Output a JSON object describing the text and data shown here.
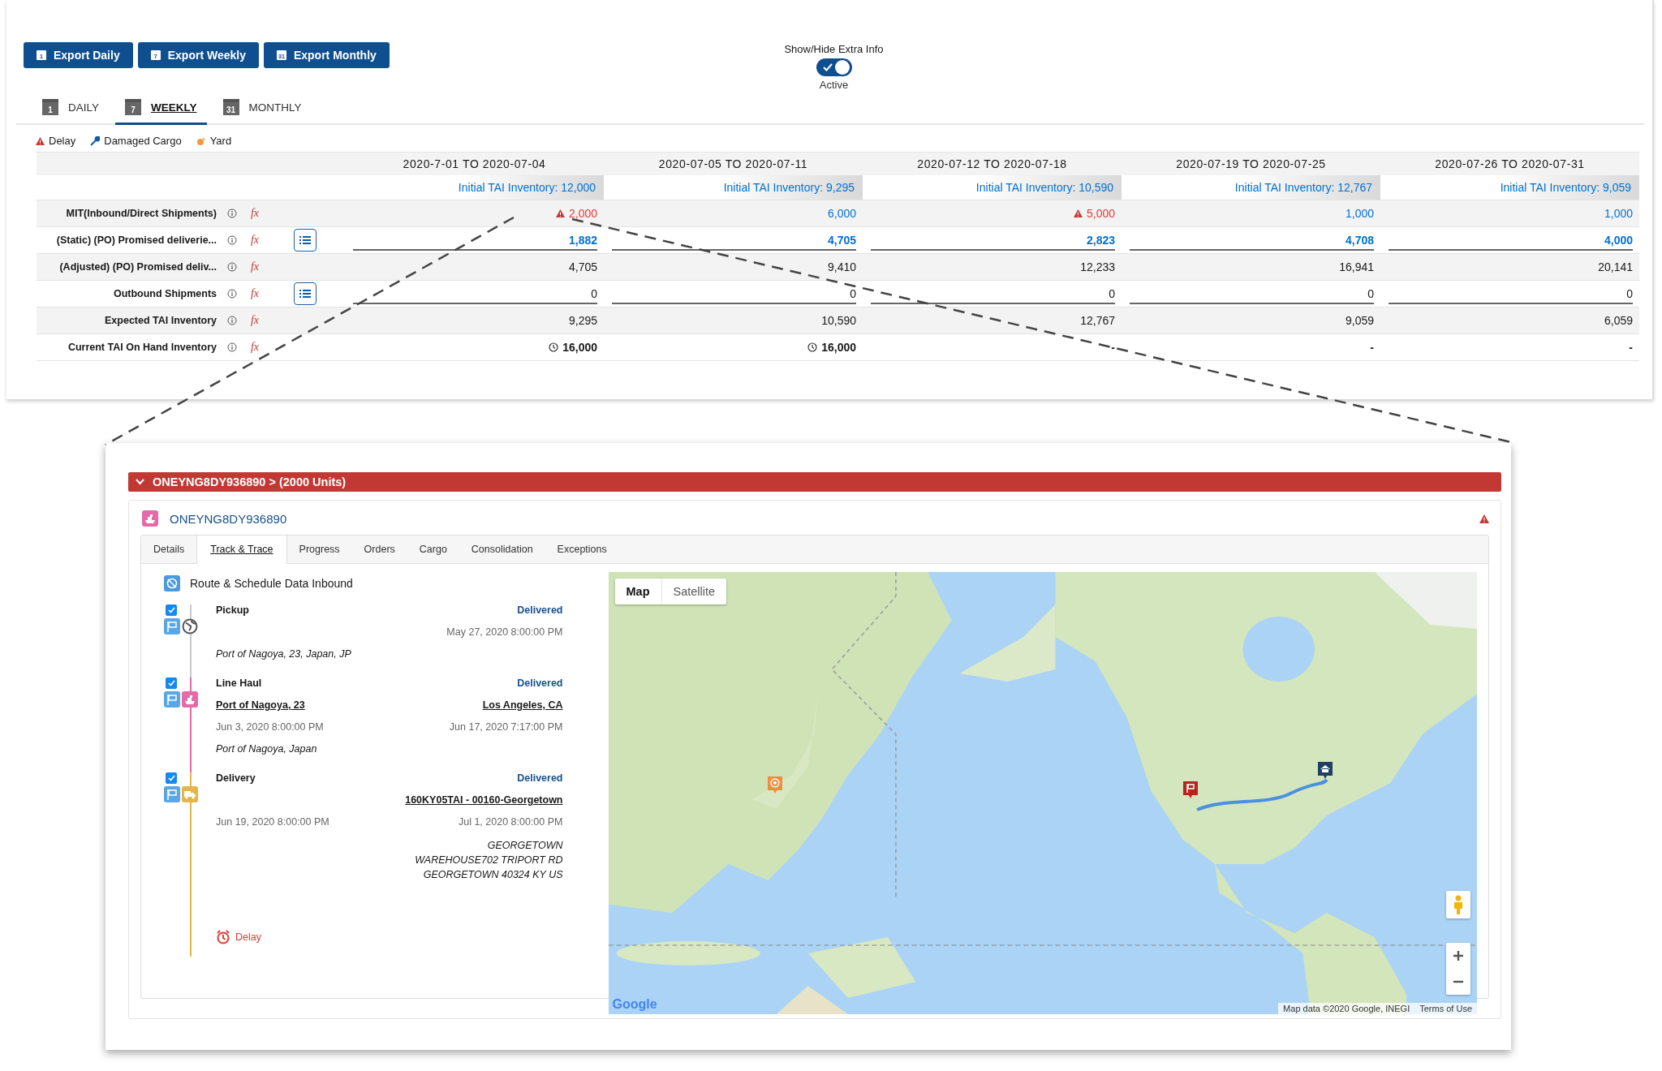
{
  "export_buttons": [
    {
      "label": "Export Daily",
      "icon_text": "1"
    },
    {
      "label": "Export Weekly",
      "icon_text": "7"
    },
    {
      "label": "Export Monthly",
      "icon_text": "31"
    }
  ],
  "toggle": {
    "label": "Show/Hide Extra Info",
    "on": true,
    "status": "Active"
  },
  "period_tabs": [
    {
      "label": "DAILY",
      "icon_text": "1",
      "selected": false
    },
    {
      "label": "WEEKLY",
      "icon_text": "7",
      "selected": true
    },
    {
      "label": "MONTHLY",
      "icon_text": "31",
      "selected": false
    }
  ],
  "legend": [
    {
      "kind": "delay",
      "label": "Delay"
    },
    {
      "kind": "damaged",
      "label": "Damaged Cargo"
    },
    {
      "kind": "yard",
      "label": "Yard"
    }
  ],
  "table": {
    "columns": [
      {
        "period": "2020-7-01 TO 2020-07-04",
        "initial": "Initial TAI Inventory: 12,000"
      },
      {
        "period": "2020-07-05 TO 2020-07-11",
        "initial": "Initial TAI Inventory: 9,295"
      },
      {
        "period": "2020-07-12 TO 2020-07-18",
        "initial": "Initial TAI Inventory: 10,590"
      },
      {
        "period": "2020-07-19 TO 2020-07-25",
        "initial": "Initial TAI Inventory: 12,767"
      },
      {
        "period": "2020-07-26 TO 2020-07-31",
        "initial": "Initial TAI Inventory: 9,059"
      }
    ],
    "rows": [
      {
        "label": "MIT(Inbound/Direct Shipments)",
        "formula": "fx",
        "kind": "link",
        "editable": false,
        "cells": [
          {
            "value": "2,000",
            "alert": true
          },
          {
            "value": "6,000",
            "alert": false
          },
          {
            "value": "5,000",
            "alert": true
          },
          {
            "value": "1,000",
            "alert": false
          },
          {
            "value": "1,000",
            "alert": false
          }
        ]
      },
      {
        "label": "(Static) (PO) Promised deliverie...",
        "formula": "fx",
        "kind": "bold-link",
        "editable": true,
        "cells": [
          {
            "value": "1,882"
          },
          {
            "value": "4,705"
          },
          {
            "value": "2,823"
          },
          {
            "value": "4,708"
          },
          {
            "value": "4,000"
          }
        ]
      },
      {
        "label": "(Adjusted) (PO) Promised deliv...",
        "formula": "fx",
        "kind": "plain",
        "editable": false,
        "cells": [
          {
            "value": "4,705"
          },
          {
            "value": "9,410"
          },
          {
            "value": "12,233"
          },
          {
            "value": "16,941"
          },
          {
            "value": "20,141"
          }
        ]
      },
      {
        "label": "Outbound Shipments",
        "formula": "fx",
        "kind": "plain",
        "editable": true,
        "cells": [
          {
            "value": "0"
          },
          {
            "value": "0"
          },
          {
            "value": "0"
          },
          {
            "value": "0"
          },
          {
            "value": "0"
          }
        ]
      },
      {
        "label": "Expected TAI Inventory",
        "formula": "fx",
        "kind": "plain",
        "editable": false,
        "cells": [
          {
            "value": "9,295"
          },
          {
            "value": "10,590"
          },
          {
            "value": "12,767"
          },
          {
            "value": "9,059"
          },
          {
            "value": "6,059"
          }
        ]
      },
      {
        "label": "Current TAI On Hand Inventory",
        "formula": "fx",
        "kind": "bold",
        "editable": false,
        "cells": [
          {
            "value": "16,000",
            "clock": true
          },
          {
            "value": "16,000",
            "clock": true
          },
          {
            "value": "-",
            "clock": false
          },
          {
            "value": "-",
            "clock": false
          },
          {
            "value": "-",
            "clock": false
          }
        ]
      }
    ]
  },
  "shipment": {
    "header": "ONEYNG8DY936890 > (2000 Units)",
    "expanded": true,
    "title": "ONEYNG8DY936890",
    "warning": true,
    "tabs": [
      {
        "label": "Details",
        "selected": false
      },
      {
        "label": "Track & Trace",
        "selected": true
      },
      {
        "label": "Progress",
        "selected": false
      },
      {
        "label": "Orders",
        "selected": false
      },
      {
        "label": "Cargo",
        "selected": false
      },
      {
        "label": "Consolidation",
        "selected": false
      },
      {
        "label": "Exceptions",
        "selected": false
      }
    ],
    "route_title": "Route & Schedule Data Inbound",
    "stops": [
      {
        "kind": "pickup",
        "name": "Pickup",
        "checked": true,
        "color": "#c9c9c9",
        "status": "Delivered",
        "dest_date": "May 27, 2020 8:00:00 PM",
        "origin_note": "Port of Nagoya, 23, Japan, JP"
      },
      {
        "kind": "line-haul",
        "name": "Line Haul",
        "checked": true,
        "color": "#e56aa7",
        "status": "Delivered",
        "origin_link": "Port of Nagoya, 23",
        "dest_link": "Los Angeles, CA",
        "origin_date": "Jun 3, 2020 8:00:00 PM",
        "dest_date": "Jun 17, 2020 7:17:00 PM",
        "origin_note": "Port of Nagoya, Japan"
      },
      {
        "kind": "delivery",
        "name": "Delivery",
        "checked": true,
        "color": "#e4b54b",
        "status": "Delivered",
        "dest_link": "160KY05TAI - 00160-Georgetown",
        "origin_date": "Jun 19, 2020 8:00:00 PM",
        "dest_date": "Jul 1, 2020 8:00:00 PM",
        "dest_note": "GEORGETOWN WAREHOUSE702 TRIPORT RD GEORGETOWN 40324 KY US"
      }
    ],
    "route_status": {
      "kind": "delay",
      "label": "Delay"
    },
    "map": {
      "types": [
        {
          "label": "Map",
          "selected": true
        },
        {
          "label": "Satellite",
          "selected": false
        }
      ],
      "logo": "Google",
      "attribution": "Map data ©2020 Google, INEGI",
      "terms": "Terms of Use"
    }
  }
}
